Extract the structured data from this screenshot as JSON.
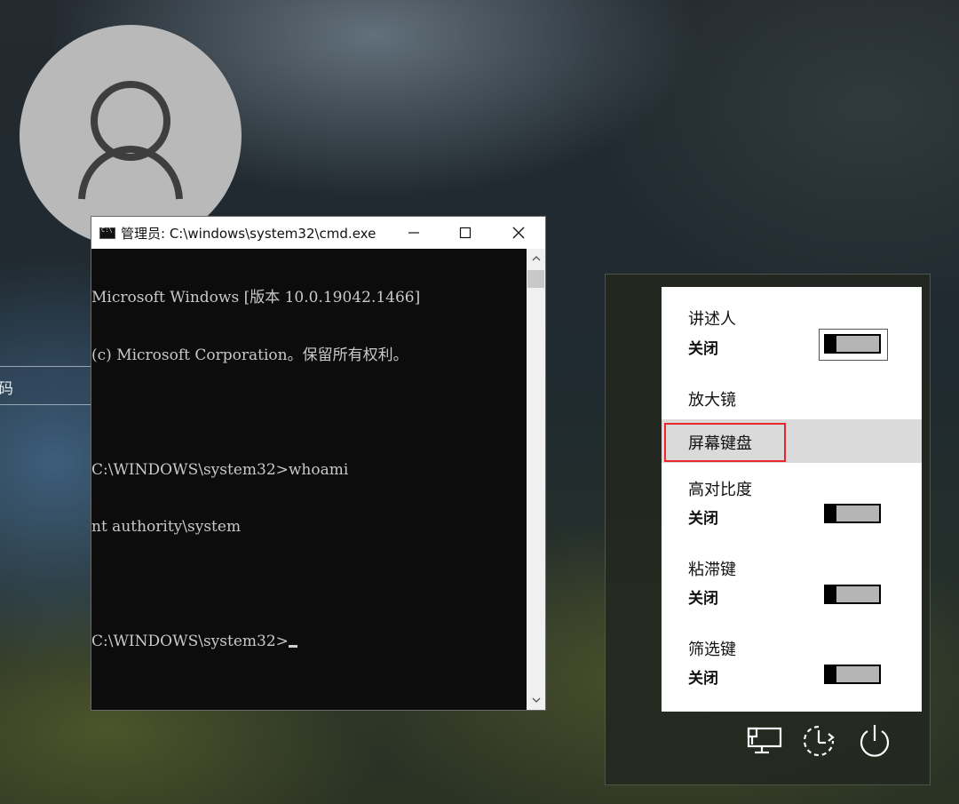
{
  "password_field": {
    "fragment": "码"
  },
  "cmd_window": {
    "title": "管理员: C:\\windows\\system32\\cmd.exe",
    "controls": {
      "minimize": "—",
      "maximize": "☐",
      "close": "✕"
    },
    "lines": [
      "Microsoft Windows [版本 10.0.19042.1466]",
      "(c) Microsoft Corporation。保留所有权利。",
      "",
      "C:\\WINDOWS\\system32>whoami",
      "nt authority\\system",
      "",
      "C:\\WINDOWS\\system32>"
    ],
    "scroll_up": "˄",
    "scroll_down": "˅"
  },
  "ease_of_access": {
    "items": [
      {
        "label": "讲述人",
        "state": "关闭",
        "toggle": true,
        "on": false
      },
      {
        "label": "放大镜",
        "toggle": false
      },
      {
        "label": "屏幕键盘",
        "toggle": false,
        "highlighted": true
      },
      {
        "label": "高对比度",
        "state": "关闭",
        "toggle": true,
        "on": false
      },
      {
        "label": "粘滞键",
        "state": "关闭",
        "toggle": true,
        "on": false
      },
      {
        "label": "筛选键",
        "state": "关闭",
        "toggle": true,
        "on": false
      }
    ],
    "highlight_color": "#e8262b"
  },
  "bottom_icons": [
    "network-icon",
    "ease-of-access-icon",
    "power-icon"
  ]
}
